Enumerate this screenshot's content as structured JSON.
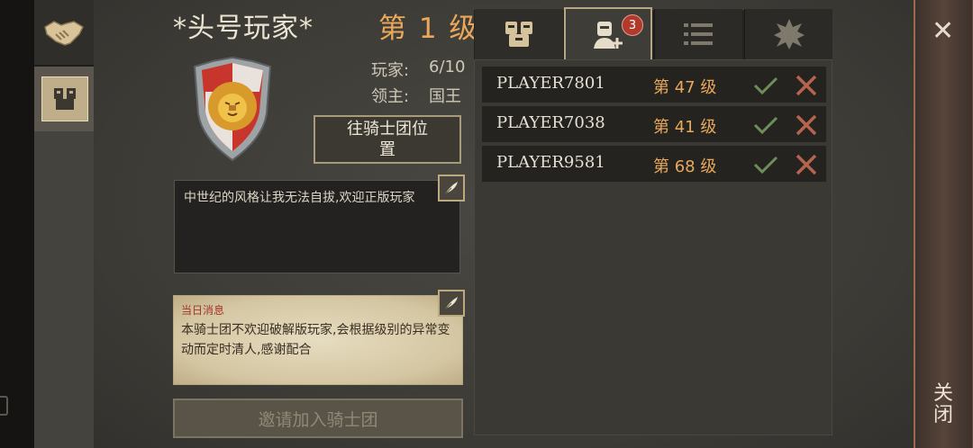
{
  "header": {
    "guild_name": "*头号玩家*",
    "guild_level": "第 1 级"
  },
  "info": {
    "players_label": "玩家:",
    "players_value": "6/10",
    "lord_label": "领主:",
    "lord_value": "国王"
  },
  "goto_button": {
    "label": "往骑士团位置"
  },
  "description": {
    "text": "中世纪的风格让我无法自拔,欢迎正版玩家"
  },
  "daily_message": {
    "title": "当日消息",
    "text": "本骑士团不欢迎破解版玩家,会根据级别的异常变动而定时清人,感谢配合"
  },
  "invite_button": {
    "label": "邀请加入骑士团"
  },
  "tabs": {
    "requests_badge": "3"
  },
  "join_requests": [
    {
      "name": "PLAYER7801",
      "level": "第 47 级"
    },
    {
      "name": "PLAYER7038",
      "level": "第 41 级"
    },
    {
      "name": "PLAYER9581",
      "level": "第 68 级"
    }
  ],
  "close": {
    "label": "关闭"
  },
  "colors": {
    "accent_orange": "#e9a85b",
    "accept_green": "#6f8f5a",
    "reject_red": "#b5654e"
  }
}
